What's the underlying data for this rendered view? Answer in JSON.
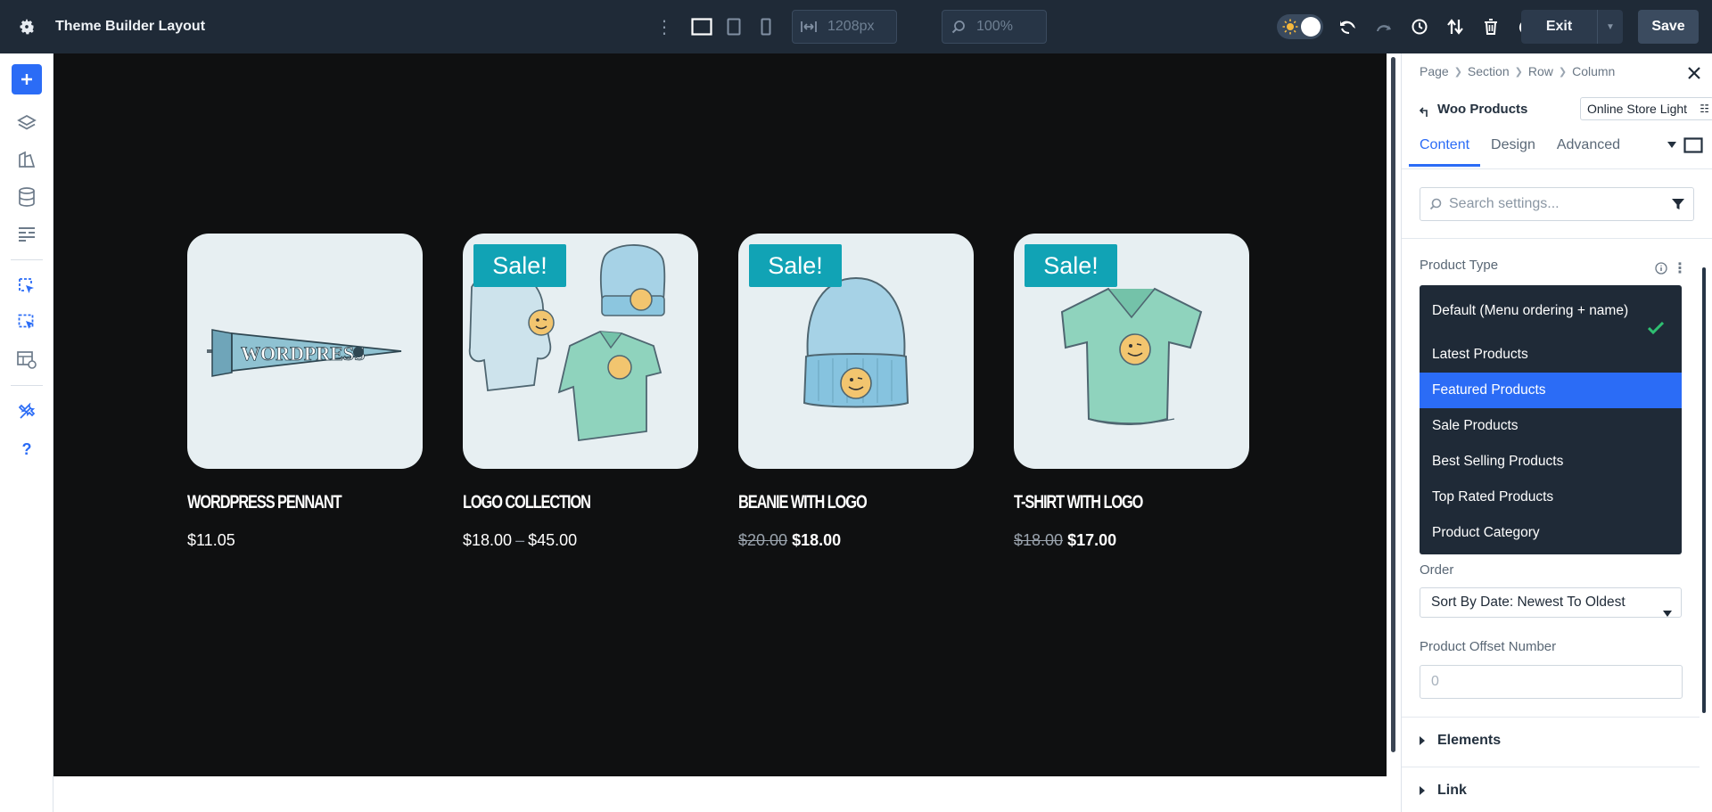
{
  "topbar": {
    "title": "Theme Builder Layout",
    "width_value": "1208px",
    "zoom_value": "100%",
    "exit_label": "Exit",
    "save_label": "Save"
  },
  "products": [
    {
      "name": "WORDPRESS PENNANT",
      "sale_badge": "",
      "price": "$11.05",
      "price_old": "",
      "price_new": "",
      "price_low": "",
      "price_high": "",
      "image": "pennant"
    },
    {
      "name": "LOGO COLLECTION",
      "sale_badge": "Sale!",
      "price": "",
      "price_old": "",
      "price_new": "",
      "price_low": "$18.00",
      "price_high": "$45.00",
      "image": "collection"
    },
    {
      "name": "BEANIE WITH LOGO",
      "sale_badge": "Sale!",
      "price": "",
      "price_old": "$20.00",
      "price_new": "$18.00",
      "price_low": "",
      "price_high": "",
      "image": "beanie"
    },
    {
      "name": "T-SHIRT WITH LOGO",
      "sale_badge": "Sale!",
      "price": "",
      "price_old": "$18.00",
      "price_new": "$17.00",
      "price_low": "",
      "price_high": "",
      "image": "tshirt"
    }
  ],
  "panel": {
    "breadcrumb": [
      "Page",
      "Section",
      "Row",
      "Column"
    ],
    "module_title": "Woo Products",
    "preset": "Online Store Light",
    "tabs": [
      "Content",
      "Design",
      "Advanced"
    ],
    "active_tab": "Content",
    "search_placeholder": "Search settings...",
    "product_type_label": "Product Type",
    "product_type_options": [
      "Default (Menu ordering + name)",
      "Latest Products",
      "Featured Products",
      "Sale Products",
      "Best Selling Products",
      "Top Rated Products",
      "Product Category"
    ],
    "product_type_selected": "Default (Menu ordering + name)",
    "product_type_highlighted": "Featured Products",
    "order_label": "Order",
    "order_value": "Sort By Date: Newest To Oldest",
    "offset_label": "Product Offset Number",
    "offset_placeholder": "0",
    "accordions": [
      "Elements",
      "Link"
    ]
  },
  "colors": {
    "accent": "#2b6cf6",
    "topbar": "#1f2a37",
    "canvas": "#0f1011",
    "sale_badge": "#11a3b5",
    "check": "#2fbf71"
  }
}
